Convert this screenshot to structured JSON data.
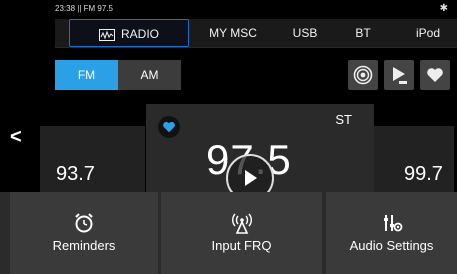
{
  "status": {
    "time": "23:38 || FM 97.5"
  },
  "tabs": [
    {
      "label": "RADIO"
    },
    {
      "label": "MY MSC"
    },
    {
      "label": "USB"
    },
    {
      "label": "BT"
    },
    {
      "label": "iPod"
    }
  ],
  "band": {
    "fm": "FM",
    "am": "AM"
  },
  "stations": {
    "left_freq": "93.7",
    "right_freq": "99.7",
    "center_freq": "97.5",
    "center_tag": "ST"
  },
  "bottom": {
    "reminders": "Reminders",
    "input_frq": "Input FRQ",
    "audio_settings": "Audio Settings"
  },
  "colors": {
    "accent": "#2aa1e6",
    "tab_border": "#1e6ec8"
  }
}
